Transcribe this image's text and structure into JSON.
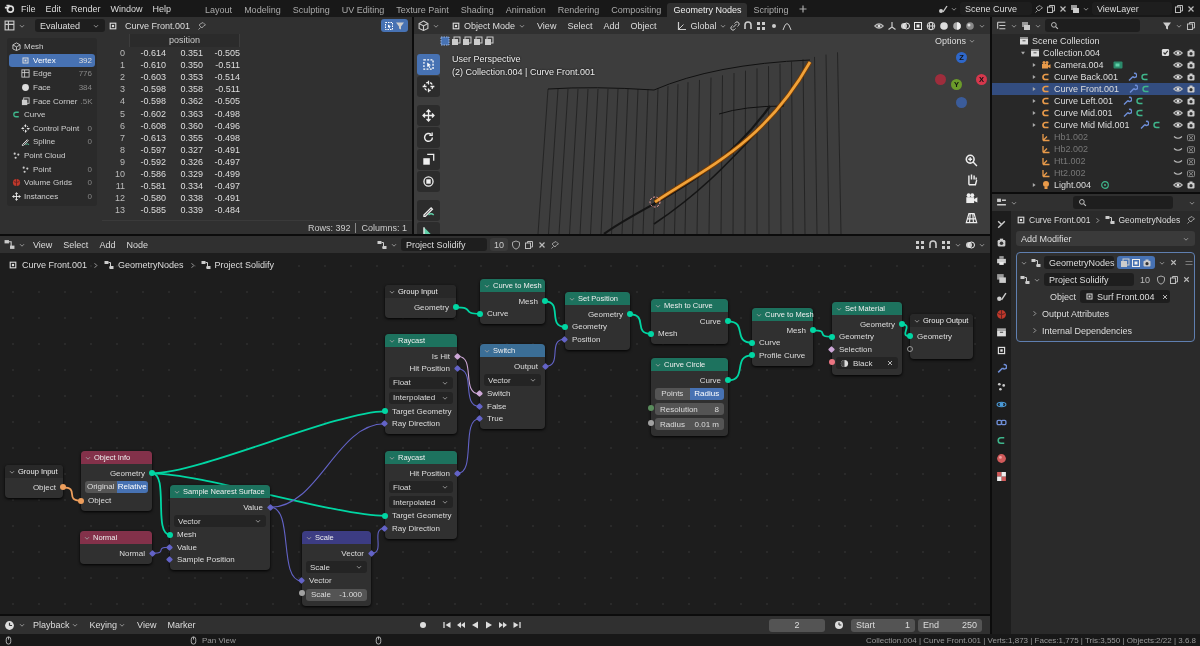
{
  "menu": [
    "File",
    "Edit",
    "Render",
    "Window",
    "Help"
  ],
  "workspaces": [
    {
      "label": "Layout",
      "selected": false
    },
    {
      "label": "Modeling",
      "selected": false
    },
    {
      "label": "Sculpting",
      "selected": false
    },
    {
      "label": "UV Editing",
      "selected": false
    },
    {
      "label": "Texture Paint",
      "selected": false
    },
    {
      "label": "Shading",
      "selected": false
    },
    {
      "label": "Animation",
      "selected": false
    },
    {
      "label": "Rendering",
      "selected": false
    },
    {
      "label": "Compositing",
      "selected": false
    },
    {
      "label": "Geometry Nodes",
      "selected": true
    },
    {
      "label": "Scripting",
      "selected": false
    }
  ],
  "scene": "Scene Curve",
  "view_layer": "ViewLayer",
  "spreadsheet": {
    "mode": "Evaluated",
    "object": "Curve Front.001",
    "domains": [
      {
        "label": "Mesh",
        "kind": "mesh",
        "children": [
          {
            "label": "Vertex",
            "count": "392",
            "kind": "vertex",
            "selected": true
          },
          {
            "label": "Edge",
            "count": "776",
            "kind": "edge",
            "selected": false
          },
          {
            "label": "Face",
            "count": "384",
            "kind": "face",
            "selected": false
          },
          {
            "label": "Face Corner",
            "count": ".5K",
            "kind": "corner",
            "selected": false
          }
        ]
      },
      {
        "label": "Curve",
        "kind": "curve",
        "children": [
          {
            "label": "Control Point",
            "count": "0",
            "kind": "control_point",
            "selected": false
          },
          {
            "label": "Spline",
            "count": "0",
            "kind": "spline",
            "selected": false
          }
        ]
      },
      {
        "label": "Point Cloud",
        "kind": "pointcloud",
        "children": [
          {
            "label": "Point",
            "count": "0",
            "kind": "point",
            "selected": false
          }
        ]
      },
      {
        "label": "Volume Grids",
        "count": "0",
        "kind": "volume",
        "selected": false
      },
      {
        "label": "Instances",
        "count": "0",
        "kind": "instances",
        "selected": false
      }
    ],
    "column": "position",
    "rows": [
      [
        "0",
        "-0.614",
        "0.351",
        "-0.505"
      ],
      [
        "1",
        "-0.610",
        "0.350",
        "-0.511"
      ],
      [
        "2",
        "-0.603",
        "0.353",
        "-0.514"
      ],
      [
        "3",
        "-0.598",
        "0.358",
        "-0.511"
      ],
      [
        "4",
        "-0.598",
        "0.362",
        "-0.505"
      ],
      [
        "5",
        "-0.602",
        "0.363",
        "-0.498"
      ],
      [
        "6",
        "-0.608",
        "0.360",
        "-0.496"
      ],
      [
        "7",
        "-0.613",
        "0.355",
        "-0.498"
      ],
      [
        "8",
        "-0.597",
        "0.327",
        "-0.491"
      ],
      [
        "9",
        "-0.592",
        "0.326",
        "-0.497"
      ],
      [
        "10",
        "-0.586",
        "0.329",
        "-0.499"
      ],
      [
        "11",
        "-0.581",
        "0.334",
        "-0.497"
      ],
      [
        "12",
        "-0.580",
        "0.338",
        "-0.491"
      ],
      [
        "13",
        "-0.585",
        "0.339",
        "-0.484"
      ]
    ],
    "row_count": "Rows: 392",
    "column_count": "Columns: 1"
  },
  "viewport": {
    "mode": "Object Mode",
    "menus": [
      "View",
      "Select",
      "Add",
      "Object"
    ],
    "orientation": "Global",
    "options": "Options",
    "view_name": "User Perspective",
    "context": "(2) Collection.004 | Curve Front.001",
    "axes": [
      {
        "label": "Z",
        "color": "#2e67c9"
      },
      {
        "label": "Y",
        "color": "#6b9b2a"
      },
      {
        "label": "X",
        "color": "#d6374c"
      }
    ]
  },
  "outliner": {
    "items": [
      {
        "label": "Scene Collection",
        "kind": "scene",
        "selected": false,
        "children": [
          {
            "label": "Collection.004",
            "kind": "collection",
            "expanded": true,
            "selected": false,
            "children": [
              {
                "label": "Camera.004",
                "kind": "camera",
                "expanded": false,
                "selected": false,
                "hidden": false
              },
              {
                "label": "Curve Back.001",
                "kind": "curve",
                "expanded": false,
                "selected": false,
                "hidden": false
              },
              {
                "label": "Curve Front.001",
                "kind": "curve",
                "expanded": false,
                "selected": true,
                "hidden": false
              },
              {
                "label": "Curve Left.001",
                "kind": "curve",
                "expanded": false,
                "selected": false,
                "hidden": false
              },
              {
                "label": "Curve Mid.001",
                "kind": "curve",
                "expanded": false,
                "selected": false,
                "hidden": false
              },
              {
                "label": "Curve Mid Mid.001",
                "kind": "curve",
                "expanded": false,
                "selected": false,
                "hidden": false
              },
              {
                "label": "Hb1.002",
                "kind": "empty",
                "selected": false,
                "hidden": true
              },
              {
                "label": "Hb2.002",
                "kind": "empty",
                "selected": false,
                "hidden": true
              },
              {
                "label": "Ht1.002",
                "kind": "empty",
                "selected": false,
                "hidden": true
              },
              {
                "label": "Ht2.002",
                "kind": "empty",
                "selected": false,
                "hidden": true
              },
              {
                "label": "Light.004",
                "kind": "light",
                "expanded": false,
                "selected": false,
                "hidden": false
              }
            ]
          }
        ]
      }
    ]
  },
  "properties": {
    "object": "Curve Front.001",
    "modifier_tab": "GeometryNodes",
    "add_modifier": "Add Modifier",
    "modifier": {
      "name": "GeometryNodes",
      "node_group": "Project Solidify",
      "users": "10",
      "object_label": "Object",
      "object": "Surf Front.004",
      "panels": [
        {
          "label": "Output Attributes",
          "expanded": false
        },
        {
          "label": "Internal Dependencies",
          "expanded": false
        }
      ]
    }
  },
  "node_editor": {
    "menus": [
      "View",
      "Select",
      "Add",
      "Node"
    ],
    "node_group": "Project Solidify",
    "users": "10",
    "breadcrumbs": [
      "Curve Front.001",
      "GeometryNodes",
      "Project Solidify"
    ],
    "nodes": [
      {
        "title": "Group Input",
        "kind": "group",
        "rows": [
          {
            "kind": "output",
            "label": "Object",
            "color": "#ed9e5c",
            "field": false
          }
        ]
      },
      {
        "title": "Object Info",
        "kind": "input",
        "rows": [
          {
            "kind": "output",
            "label": "Geometry",
            "color": "#00d6a3",
            "field": false
          },
          {
            "kind": "toggle",
            "options": [
              {
                "label": "Original",
                "selected": false
              },
              {
                "label": "Relative",
                "selected": true
              }
            ]
          },
          {
            "kind": "input",
            "label": "Object",
            "color": "#ed9e5c",
            "field": false
          }
        ]
      },
      {
        "title": "Normal",
        "kind": "input",
        "rows": [
          {
            "kind": "output",
            "label": "Normal",
            "color": "#6363c7",
            "field": true
          }
        ]
      },
      {
        "title": "Sample Nearest Surface",
        "kind": "geometry",
        "rows": [
          {
            "kind": "output",
            "label": "Value",
            "color": "#6363c7",
            "field": true
          },
          {
            "kind": "enum",
            "label": "Vector"
          },
          {
            "kind": "input",
            "label": "Mesh",
            "color": "#00d6a3",
            "field": false
          },
          {
            "kind": "input",
            "label": "Value",
            "color": "#6363c7",
            "field": true
          },
          {
            "kind": "input",
            "label": "Sample Position",
            "color": "#6363c7",
            "field": true
          }
        ]
      },
      {
        "title": "Scale",
        "kind": "vector",
        "rows": [
          {
            "kind": "output",
            "label": "Vector",
            "color": "#6363c7",
            "field": true
          },
          {
            "kind": "enum",
            "label": "Scale"
          },
          {
            "kind": "input",
            "label": "Vector",
            "color": "#6363c7",
            "field": true
          },
          {
            "kind": "field",
            "label": "Scale",
            "value": "-1.000",
            "color": "#a1a1a1",
            "field": false
          }
        ]
      },
      {
        "title": "Group Input",
        "kind": "group",
        "rows": [
          {
            "kind": "output",
            "label": "Geometry",
            "color": "#00d6a3",
            "field": false
          }
        ]
      },
      {
        "title": "Raycast",
        "kind": "geometry",
        "rows": [
          {
            "kind": "output",
            "label": "Is Hit",
            "color": "#cca6d6",
            "field": true
          },
          {
            "kind": "output",
            "label": "Hit Position",
            "color": "#6363c7",
            "field": true
          },
          {
            "kind": "enum",
            "label": "Float"
          },
          {
            "kind": "enum",
            "label": "Interpolated"
          },
          {
            "kind": "input",
            "label": "Target Geometry",
            "color": "#00d6a3",
            "field": false
          },
          {
            "kind": "input",
            "label": "Ray Direction",
            "color": "#6363c7",
            "field": true
          }
        ]
      },
      {
        "title": "Raycast",
        "kind": "geometry",
        "rows": [
          {
            "kind": "output",
            "label": "Hit Position",
            "color": "#6363c7",
            "field": true
          },
          {
            "kind": "enum",
            "label": "Float"
          },
          {
            "kind": "enum",
            "label": "Interpolated"
          },
          {
            "kind": "input",
            "label": "Target Geometry",
            "color": "#00d6a3",
            "field": false
          },
          {
            "kind": "input",
            "label": "Ray Direction",
            "color": "#6363c7",
            "field": true
          }
        ]
      },
      {
        "title": "Curve to Mesh",
        "kind": "geometry",
        "rows": [
          {
            "kind": "output",
            "label": "Mesh",
            "color": "#00d6a3",
            "field": false
          },
          {
            "kind": "input",
            "label": "Curve",
            "color": "#00d6a3",
            "field": false
          }
        ]
      },
      {
        "title": "Switch",
        "kind": "utility",
        "rows": [
          {
            "kind": "output",
            "label": "Output",
            "color": "#6363c7",
            "field": true
          },
          {
            "kind": "enum",
            "label": "Vector"
          },
          {
            "kind": "input",
            "label": "Switch",
            "color": "#cca6d6",
            "field": true
          },
          {
            "kind": "input",
            "label": "False",
            "color": "#6363c7",
            "field": true
          },
          {
            "kind": "input",
            "label": "True",
            "color": "#6363c7",
            "field": true
          }
        ]
      },
      {
        "title": "Set Position",
        "kind": "geometry",
        "rows": [
          {
            "kind": "output",
            "label": "Geometry",
            "color": "#00d6a3",
            "field": false
          },
          {
            "kind": "input",
            "label": "Geometry",
            "color": "#00d6a3",
            "field": false
          },
          {
            "kind": "input",
            "label": "Position",
            "color": "#6363c7",
            "field": true
          }
        ]
      },
      {
        "title": "Mesh to Curve",
        "kind": "geometry",
        "rows": [
          {
            "kind": "output",
            "label": "Curve",
            "color": "#00d6a3",
            "field": false
          },
          {
            "kind": "input",
            "label": "Mesh",
            "color": "#00d6a3",
            "field": false
          }
        ]
      },
      {
        "title": "Curve Circle",
        "kind": "geometry",
        "rows": [
          {
            "kind": "output",
            "label": "Curve",
            "color": "#00d6a3",
            "field": false
          },
          {
            "kind": "toggle",
            "options": [
              {
                "label": "Points",
                "selected": false
              },
              {
                "label": "Radius",
                "selected": true
              }
            ]
          },
          {
            "kind": "field",
            "label": "Resolution",
            "value": "8",
            "color": "#598c5c",
            "field": false
          },
          {
            "kind": "field",
            "label": "Radius",
            "value": "0.01 m",
            "color": "#a1a1a1",
            "field": false
          }
        ]
      },
      {
        "title": "Curve to Mesh",
        "kind": "geometry",
        "rows": [
          {
            "kind": "output",
            "label": "Mesh",
            "color": "#00d6a3",
            "field": false
          },
          {
            "kind": "input",
            "label": "Curve",
            "color": "#00d6a3",
            "field": false
          },
          {
            "kind": "input",
            "label": "Profile Curve",
            "color": "#00d6a3",
            "field": false
          }
        ]
      },
      {
        "title": "Set Material",
        "kind": "geometry",
        "rows": [
          {
            "kind": "output",
            "label": "Geometry",
            "color": "#00d6a3",
            "field": false
          },
          {
            "kind": "input",
            "label": "Geometry",
            "color": "#00d6a3",
            "field": false
          },
          {
            "kind": "input",
            "label": "Selection",
            "color": "#cca6d6",
            "field": true
          },
          {
            "kind": "material",
            "label": "Black",
            "color": "#eb7582",
            "field": false
          }
        ]
      },
      {
        "title": "Group Output",
        "kind": "group",
        "rows": [
          {
            "kind": "input",
            "label": "Geometry",
            "color": "#00d6a3",
            "field": false
          },
          {
            "kind": "virtual"
          }
        ]
      }
    ]
  },
  "timeline": {
    "menus": [
      {
        "label": "Playback",
        "dropdown": true
      },
      {
        "label": "Keying",
        "dropdown": true
      },
      {
        "label": "View",
        "dropdown": false
      },
      {
        "label": "Marker",
        "dropdown": false
      }
    ],
    "current_frame": "2",
    "start_label": "Start",
    "start": "1",
    "end_label": "End",
    "end": "250"
  },
  "status_bar": {
    "hint": "Pan View",
    "stats": "Collection.004 | Curve Front.001 | Verts:1,873 | Faces:1,775 | Tris:3,550 | Objects:2/22 | 3.6.8"
  }
}
